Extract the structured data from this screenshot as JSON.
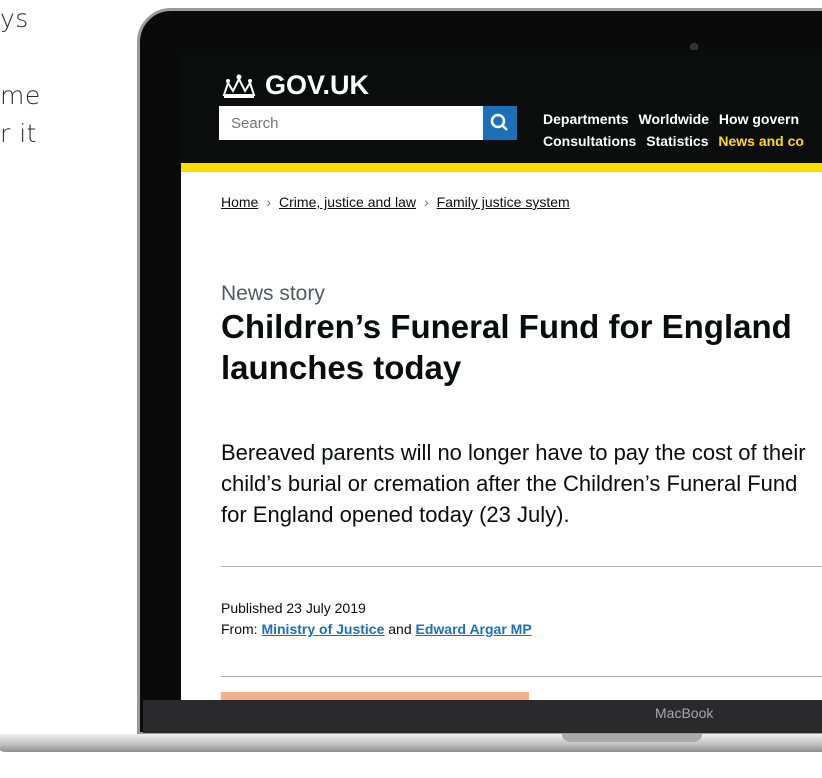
{
  "background_text": {
    "line1": "ys",
    "line2": "me",
    "line3": "r it"
  },
  "header": {
    "brand": "GOV.UK",
    "search_placeholder": "Search",
    "nav_row1": [
      "Departments",
      "Worldwide",
      "How govern"
    ],
    "nav_row2": [
      "Consultations",
      "Statistics",
      "News and co"
    ]
  },
  "breadcrumbs": [
    "Home",
    "Crime, justice and law",
    "Family justice system"
  ],
  "article": {
    "kind": "News story",
    "title": "Children’s Funeral Fund for England launches today",
    "lead": "Bereaved parents will no longer have to pay the cost of their child’s burial or cremation after the Children’s Funeral Fund for England opened today (23 July).",
    "published": "Published 23 July 2019",
    "from_label": "From:",
    "from_org": "Ministry of Justice",
    "and": "and",
    "from_person": "Edward Argar MP"
  },
  "device": {
    "label": "MacBook"
  },
  "colors": {
    "header_bg": "#0b0c0c",
    "accent_yellow": "#ffdd00",
    "link_blue": "#1d70b8",
    "promo": "#f4b08a"
  }
}
